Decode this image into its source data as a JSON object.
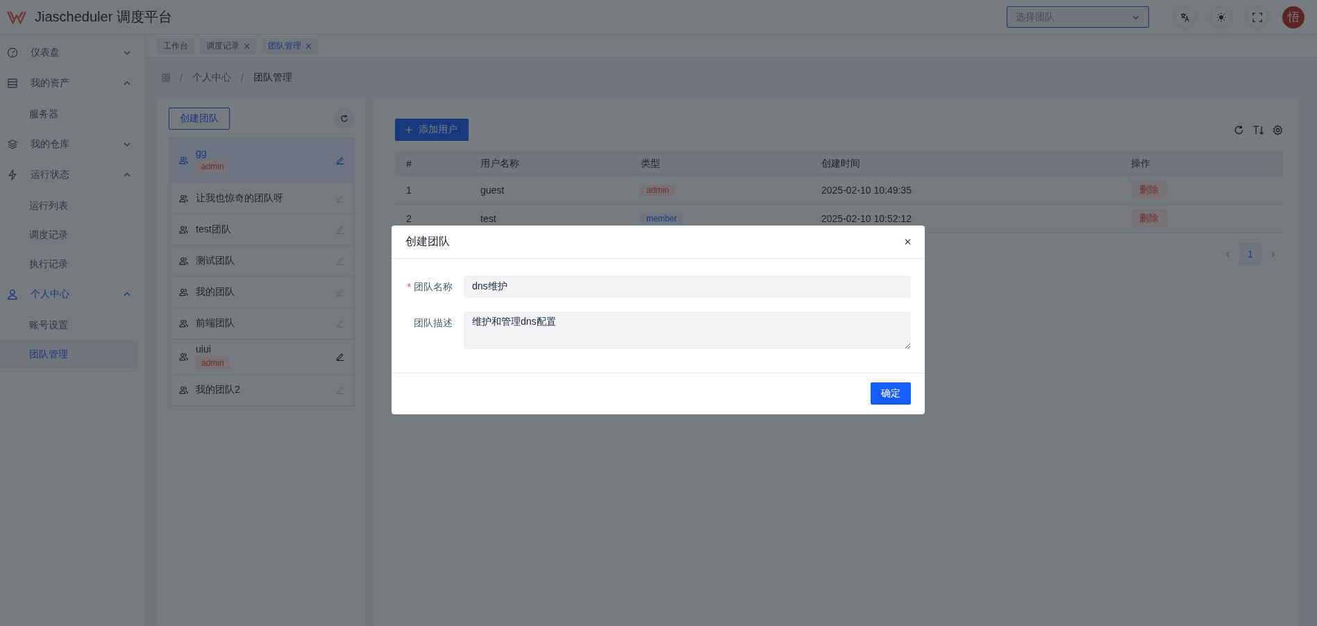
{
  "header": {
    "app_title": "Jiascheduler 调度平台",
    "team_select": {
      "placeholder": "选择团队"
    },
    "avatar": "悟"
  },
  "sidebar": {
    "items": [
      {
        "label": "仪表盘",
        "expanded": false,
        "selected": false
      },
      {
        "label": "我的资产",
        "expanded": true,
        "selected": false,
        "children": [
          {
            "label": "服务器",
            "selected": false
          }
        ]
      },
      {
        "label": "我的仓库",
        "expanded": false,
        "selected": false
      },
      {
        "label": "运行状态",
        "expanded": true,
        "selected": false,
        "children": [
          {
            "label": "运行列表",
            "selected": false
          },
          {
            "label": "调度记录",
            "selected": false
          },
          {
            "label": "执行记录",
            "selected": false
          }
        ]
      },
      {
        "label": "个人中心",
        "expanded": true,
        "selected": true,
        "children": [
          {
            "label": "账号设置",
            "selected": false
          },
          {
            "label": "团队管理",
            "selected": true
          }
        ]
      }
    ]
  },
  "tabs": [
    {
      "label": "工作台",
      "closable": false,
      "selected": false
    },
    {
      "label": "调度记录",
      "closable": true,
      "selected": false
    },
    {
      "label": "团队管理",
      "closable": true,
      "selected": true
    }
  ],
  "breadcrumb": {
    "separator": "/",
    "items": [
      "个人中心",
      "团队管理"
    ]
  },
  "teams_panel": {
    "create_button": "创建团队",
    "teams": [
      {
        "name": "gg",
        "selected": true,
        "role": {
          "label": "admin",
          "kind": "danger"
        }
      },
      {
        "name": "让我也惊奇的团队呀",
        "selected": false
      },
      {
        "name": "test团队",
        "selected": false
      },
      {
        "name": "测试团队",
        "selected": false
      },
      {
        "name": "我的团队",
        "selected": false
      },
      {
        "name": "前端团队",
        "selected": false
      },
      {
        "name": "uiui",
        "selected": false,
        "role": {
          "label": "admin",
          "kind": "danger"
        }
      },
      {
        "name": "我的团队2",
        "selected": false
      }
    ]
  },
  "users_panel": {
    "add_button": "添加用户",
    "table": {
      "columns": [
        "#",
        "用户名称",
        "类型",
        "创建时间",
        "操作"
      ],
      "rows": [
        {
          "index": "1",
          "name": "guest",
          "type": {
            "label": "admin",
            "kind": "danger"
          },
          "created": "2025-02-10 10:49:35",
          "action": "删除"
        },
        {
          "index": "2",
          "name": "test",
          "type": {
            "label": "member",
            "kind": "primary"
          },
          "created": "2025-02-10 10:52:12",
          "action": "删除"
        }
      ]
    },
    "pagination": [
      {
        "label": "1",
        "selected": true
      }
    ]
  },
  "modal": {
    "title": "创建团队",
    "required_mark": "*",
    "fields": [
      {
        "kind": "input",
        "label": "团队名称",
        "required": true,
        "value": "dns维护"
      },
      {
        "kind": "textarea",
        "label": "团队描述",
        "required": false,
        "value": "维护和管理dns配置"
      }
    ],
    "confirm_button": "确定"
  }
}
